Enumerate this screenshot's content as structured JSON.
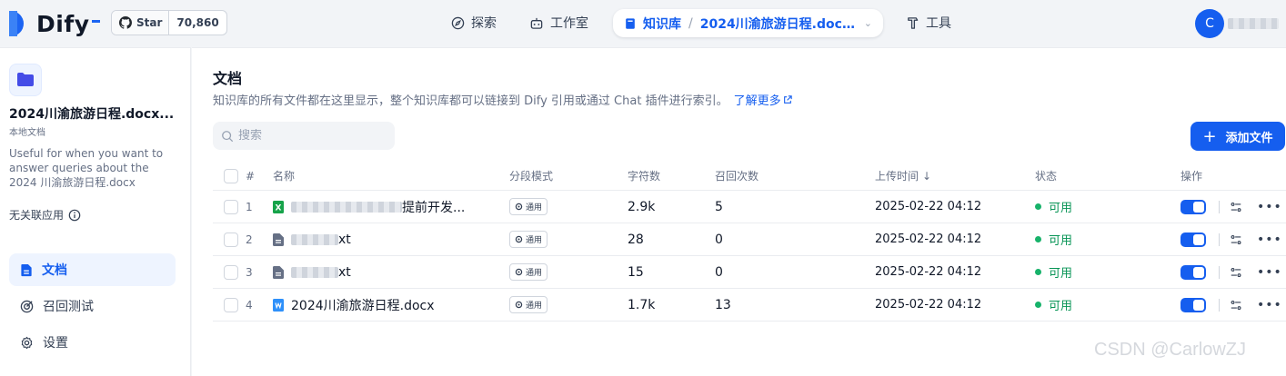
{
  "app": {
    "logo_text": "Dify",
    "github_star_label": "Star",
    "github_star_count": "70,860"
  },
  "nav": {
    "explore": "探索",
    "studio": "工作室",
    "knowledge": "知识库",
    "current_doc": "2024川渝旅游日程.docx...",
    "tools": "工具"
  },
  "user": {
    "avatar_letter": "C"
  },
  "sidebar": {
    "kb_name": "2024川渝旅游日程.docx...",
    "kb_type": "本地文档",
    "description": "Useful for when you want to answer queries about the 2024 川渝旅游日程.docx",
    "linked_apps": "无关联应用",
    "menu": [
      {
        "label": "文档",
        "icon": "document-icon",
        "active": true
      },
      {
        "label": "召回测试",
        "icon": "target-icon",
        "active": false
      },
      {
        "label": "设置",
        "icon": "gear-icon",
        "active": false
      }
    ]
  },
  "main": {
    "title": "文档",
    "subtitle": "知识库的所有文件都在这里显示，整个知识库都可以链接到 Dify 引用或通过 Chat 插件进行索引。",
    "learn_more": "了解更多",
    "search_placeholder": "搜索",
    "add_button": "添加文件",
    "columns": {
      "index": "#",
      "name": "名称",
      "mode": "分段模式",
      "chars": "字符数",
      "recall": "召回次数",
      "upload_time": "上传时间",
      "status": "状态",
      "actions": "操作"
    },
    "rows": [
      {
        "index": "1",
        "name": "提前开发...",
        "file_type": "xlsx",
        "mode": "通用",
        "chars": "2.9k",
        "recall": "5",
        "upload_time": "2025-02-22 04:12",
        "status": "可用",
        "enabled": true
      },
      {
        "index": "2",
        "name": "xt",
        "file_type": "txt",
        "mode": "通用",
        "chars": "28",
        "recall": "0",
        "upload_time": "2025-02-22 04:12",
        "status": "可用",
        "enabled": true
      },
      {
        "index": "3",
        "name": "xt",
        "file_type": "txt",
        "mode": "通用",
        "chars": "15",
        "recall": "0",
        "upload_time": "2025-02-22 04:12",
        "status": "可用",
        "enabled": true
      },
      {
        "index": "4",
        "name": "2024川渝旅游日程.docx",
        "file_type": "docx",
        "mode": "通用",
        "chars": "1.7k",
        "recall": "13",
        "upload_time": "2025-02-22 04:12",
        "status": "可用",
        "enabled": true
      }
    ]
  },
  "watermark": "CSDN @CarlowZJ",
  "colors": {
    "accent": "#155eef",
    "success": "#17b26a",
    "excel": "#16a34a"
  }
}
